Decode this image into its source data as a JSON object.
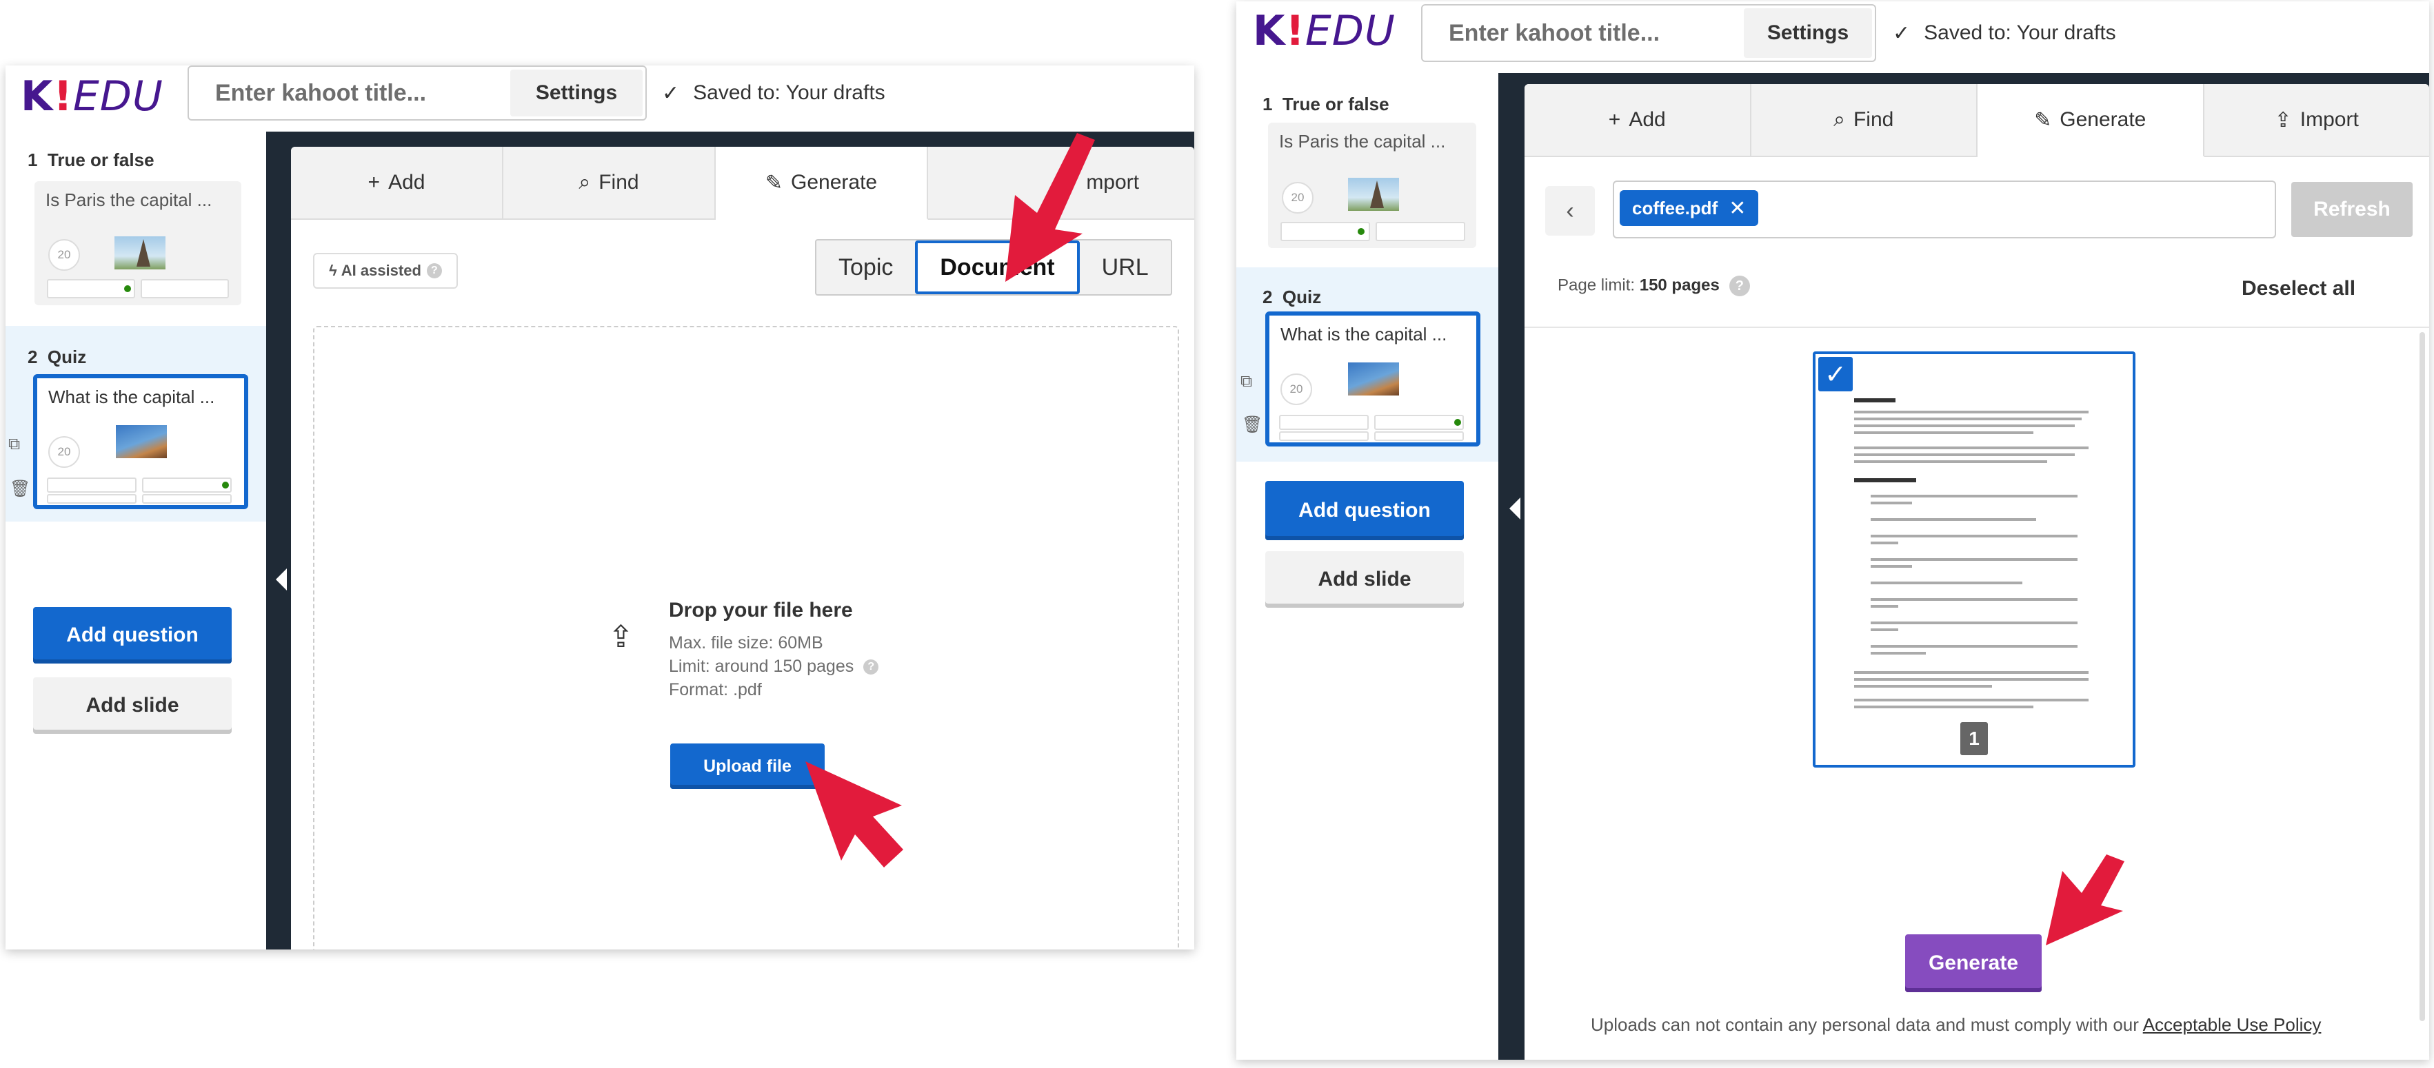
{
  "brand": {
    "logo_k": "K",
    "logo_bang": "!",
    "logo_edu": "EDU"
  },
  "header": {
    "title_placeholder": "Enter kahoot title...",
    "settings_label": "Settings",
    "saved_text": "Saved to: Your drafts"
  },
  "sidebar": {
    "questions": [
      {
        "number": "1",
        "type": "True or false",
        "text": "Is Paris the capital ...",
        "time": "20"
      },
      {
        "number": "2",
        "type": "Quiz",
        "text": "What is the capital ...",
        "time": "20"
      }
    ],
    "add_question_label": "Add question",
    "add_slide_label": "Add slide"
  },
  "tabs": [
    {
      "icon": "plus-icon",
      "label": "Add"
    },
    {
      "icon": "search-icon",
      "label": "Find"
    },
    {
      "icon": "magic-wand-icon",
      "label": "Generate"
    },
    {
      "icon": "upload-icon",
      "label": "Import"
    }
  ],
  "left_tab_import_partial": "mport",
  "generate": {
    "ai_badge": "AI assisted",
    "source_options": [
      "Topic",
      "Document",
      "URL"
    ],
    "selected_source": "Document",
    "dropzone": {
      "title": "Drop your file here",
      "max_size": "Max. file size: 60MB",
      "limit": "Limit: around 150 pages",
      "format": "Format: .pdf",
      "upload_label": "Upload file"
    }
  },
  "document_view": {
    "file_chip": "coffee.pdf",
    "refresh_label": "Refresh",
    "page_limit_label": "Page limit:",
    "page_limit_value": "150 pages",
    "deselect_all_label": "Deselect all",
    "page_number": "1",
    "generate_label": "Generate",
    "policy_text": "Uploads can not contain any personal data and must comply with our",
    "policy_link": "Acceptable Use Policy"
  },
  "colors": {
    "brand_purple": "#46178f",
    "primary_blue": "#1368ce",
    "generate_purple": "#864cbf",
    "annotation_red": "#e21b3c",
    "dark_backdrop": "#1f2a36"
  }
}
